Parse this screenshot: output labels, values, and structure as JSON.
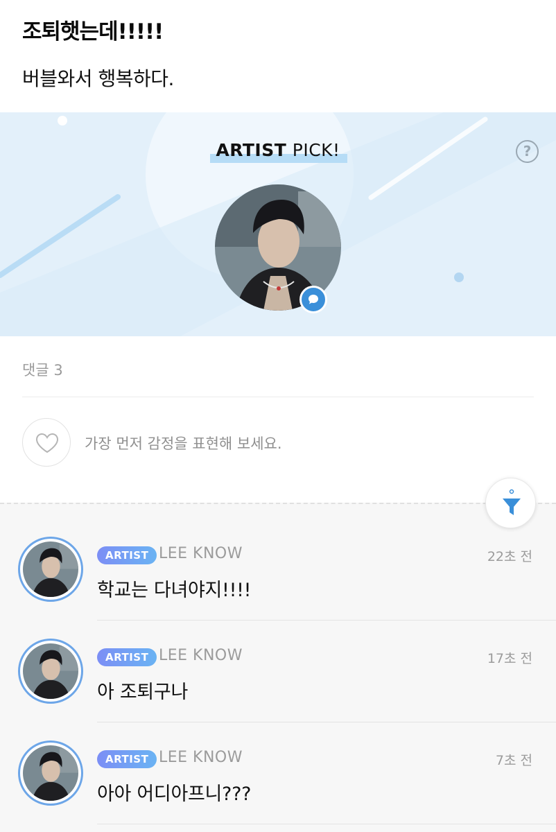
{
  "post": {
    "title": "조퇴햇는데!!!!!",
    "body": "버블와서 행복하다."
  },
  "artist_pick": {
    "heading_bold": "ARTIST",
    "heading_rest": " PICK!",
    "help_icon": "question-circle-icon",
    "accent_color": "#3a8fd9",
    "banner_color": "#e3f0fa"
  },
  "comments_section": {
    "count_label": "댓글 3",
    "like_prompt": "가장 먼저 감정을 표현해 보세요."
  },
  "comments": [
    {
      "badge": "ARTIST",
      "author": "LEE KNOW",
      "time": "22초 전",
      "text": "학교는 다녀야지!!!!"
    },
    {
      "badge": "ARTIST",
      "author": "LEE KNOW",
      "time": "17초 전",
      "text": "아 조퇴구나"
    },
    {
      "badge": "ARTIST",
      "author": "LEE KNOW",
      "time": "7초 전",
      "text": "아아 어디아프니???"
    }
  ]
}
